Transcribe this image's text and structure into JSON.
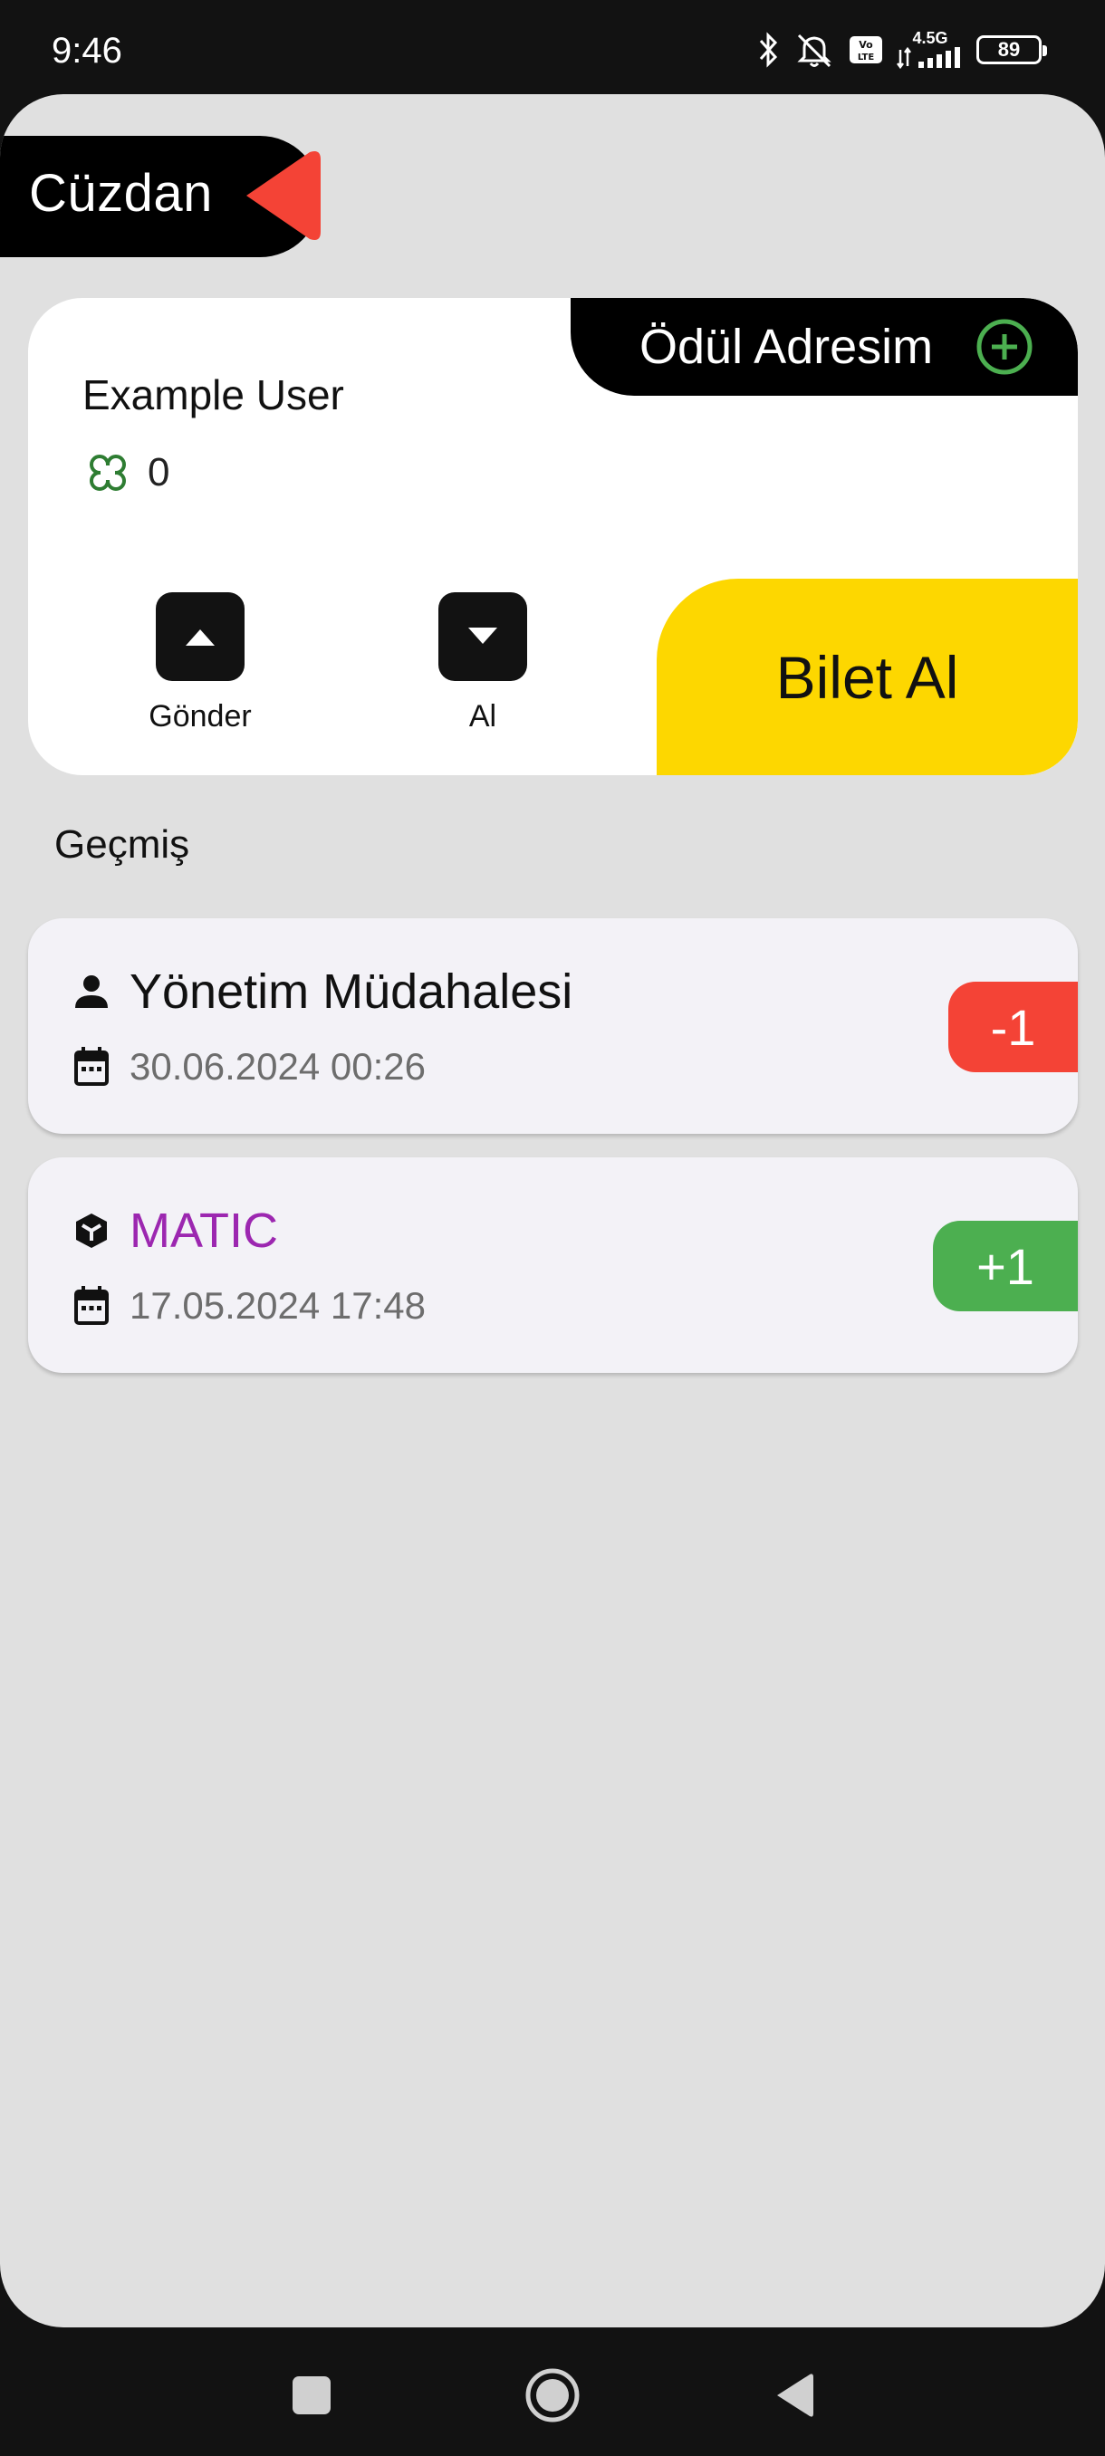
{
  "status_bar": {
    "time": "9:46",
    "network": "4.5G",
    "battery": "89"
  },
  "header": {
    "title": "Cüzdan"
  },
  "wallet": {
    "reward_label": "Ödül Adresim",
    "user_name": "Example User",
    "balance": "0",
    "send_label": "Gönder",
    "receive_label": "Al",
    "buy_label": "Bilet Al"
  },
  "history": {
    "title": "Geçmiş",
    "items": [
      {
        "title": "Yönetim Müdahalesi",
        "date": "30.06.2024 00:26",
        "amount": "-1",
        "icon": "person-icon"
      },
      {
        "title": "MATIC",
        "date": "17.05.2024 17:48",
        "amount": "+1",
        "icon": "cube-icon"
      }
    ]
  },
  "colors": {
    "accent_red": "#f44336",
    "accent_green": "#4caf50",
    "accent_yellow": "#fdd700",
    "matic_purple": "#9c27b0"
  }
}
